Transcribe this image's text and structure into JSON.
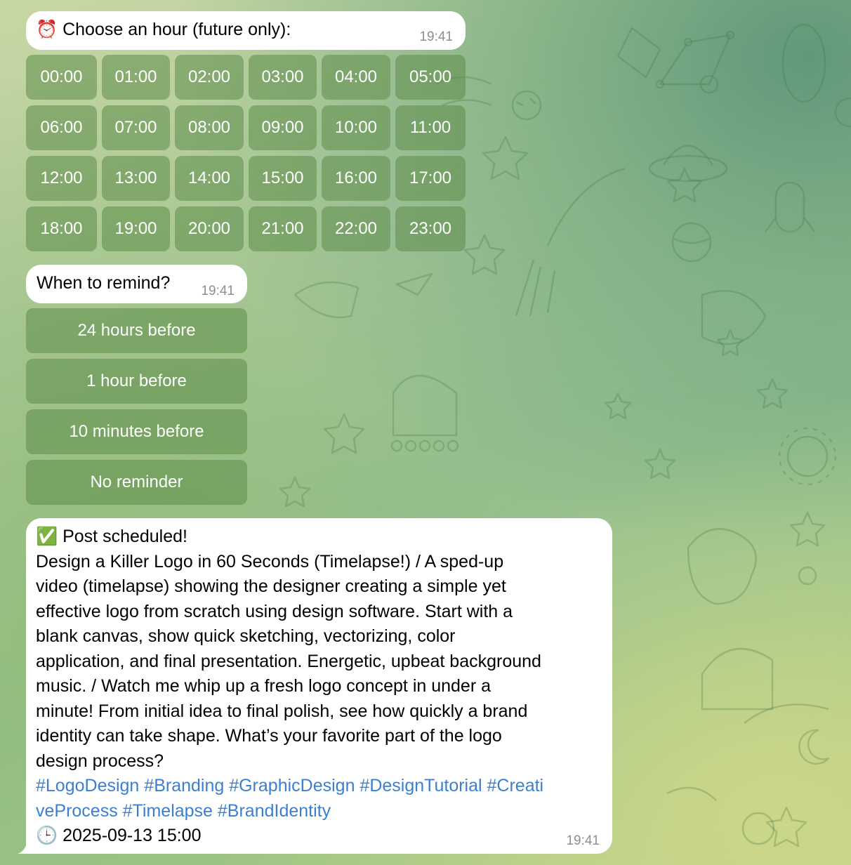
{
  "messages": {
    "hour_prompt": {
      "icon": "alarm-clock-icon",
      "emoji": "⏰",
      "text": "Choose an hour (future only):",
      "time": "19:41"
    },
    "hours": [
      "00:00",
      "01:00",
      "02:00",
      "03:00",
      "04:00",
      "05:00",
      "06:00",
      "07:00",
      "08:00",
      "09:00",
      "10:00",
      "11:00",
      "12:00",
      "13:00",
      "14:00",
      "15:00",
      "16:00",
      "17:00",
      "18:00",
      "19:00",
      "20:00",
      "21:00",
      "22:00",
      "23:00"
    ],
    "remind_prompt": {
      "text": "When to remind?",
      "time": "19:41"
    },
    "remind_options": [
      "24 hours before",
      "1 hour before",
      "10 minutes before",
      "No reminder"
    ],
    "scheduled": {
      "icon": "check-mark-icon",
      "emoji": "✅",
      "title": "Post scheduled!",
      "body_lines": [
        "Design a Killer Logo in 60 Seconds (Timelapse!) / A sped-up",
        "video (timelapse) showing the designer creating a simple yet",
        "effective logo from scratch using design software. Start with a",
        "blank canvas, show quick sketching, vectorizing, color",
        "application, and final presentation. Energetic, upbeat background",
        "music. / Watch me whip up a fresh logo concept in under a",
        "minute! From initial idea to final polish, see how quickly a brand",
        "identity can take shape. What’s your favorite part of the logo",
        "design process?"
      ],
      "hashtag_lines": [
        "#LogoDesign #Branding #GraphicDesign #DesignTutorial #Creati",
        "veProcess #Timelapse #BrandIdentity"
      ],
      "date_icon": "clock-icon",
      "date_emoji": "🕒",
      "date": "2025-09-13 15:00",
      "time": "19:41"
    }
  },
  "colors": {
    "bubble": "#ffffff",
    "keyboard_button": "#5c8c48",
    "hashtag": "#3d7fcf",
    "timestamp": "#8e8e93"
  }
}
